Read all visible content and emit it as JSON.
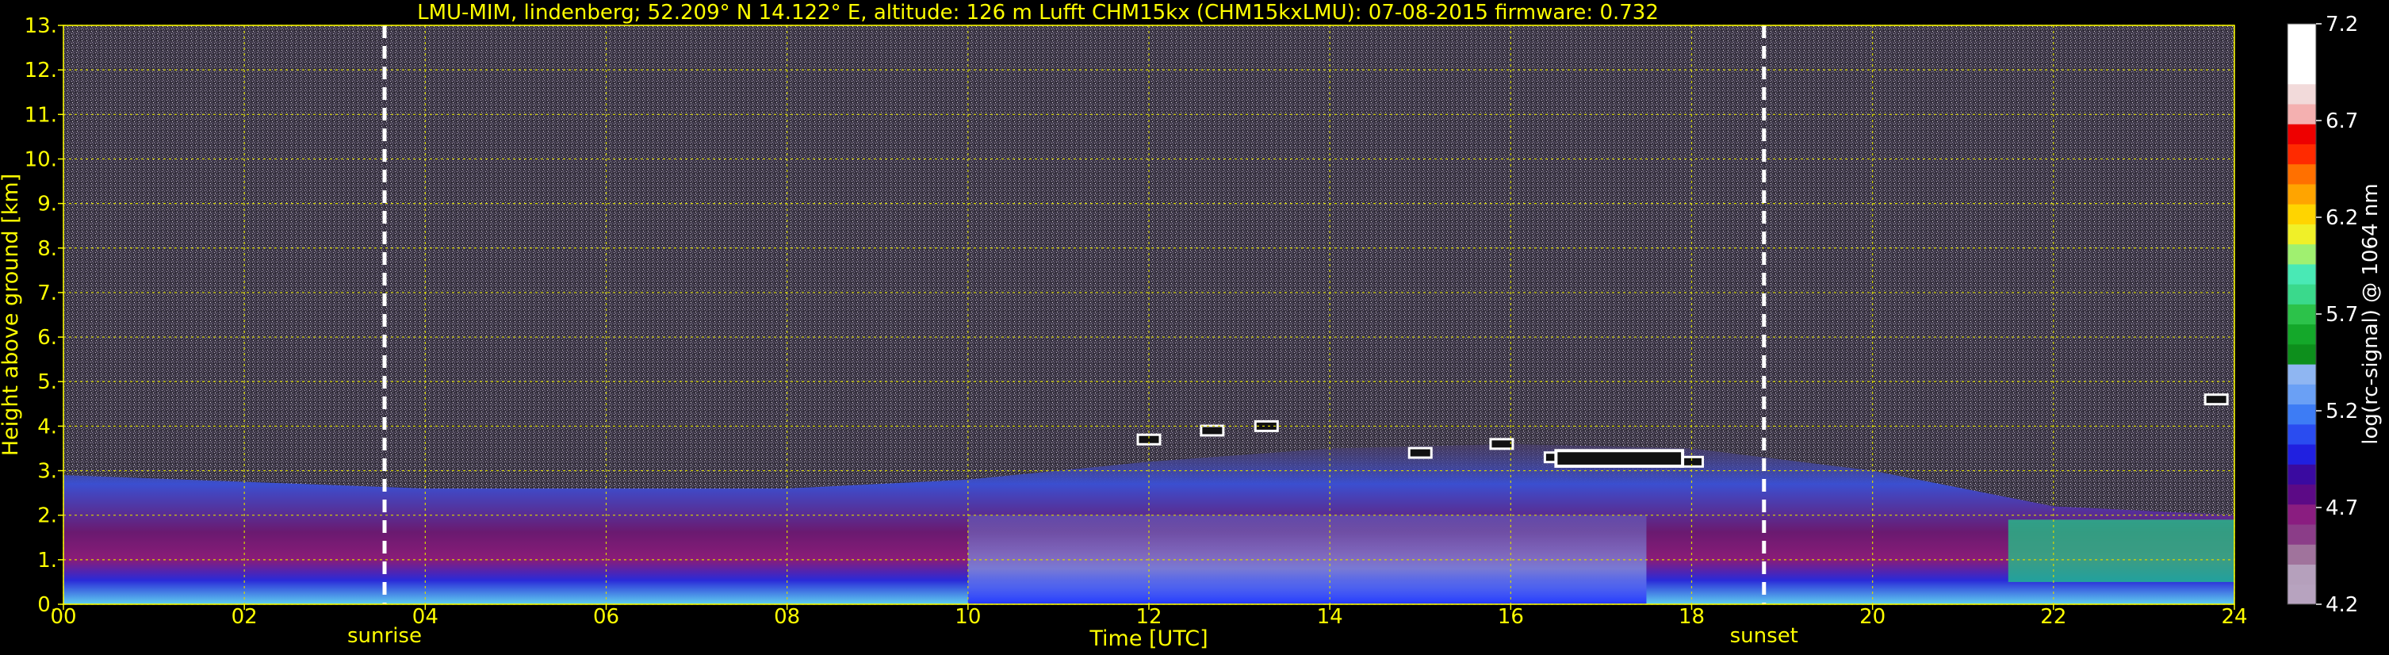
{
  "chart_data": {
    "type": "heatmap",
    "title": "LMU-MIM, lindenberg; 52.209° N 14.122° E, altitude: 126 m    Lufft CHM15kx (CHM15kxLMU): 07-08-2015    firmware: 0.732",
    "xlabel": "Time [UTC]",
    "ylabel": "Height above ground [km]",
    "xlim": [
      0,
      24
    ],
    "ylim": [
      0,
      13
    ],
    "x_ticks": [
      "00",
      "02",
      "04",
      "06",
      "08",
      "10",
      "12",
      "14",
      "16",
      "18",
      "20",
      "22",
      "24"
    ],
    "y_ticks": [
      "0.",
      "1.",
      "2.",
      "3.",
      "4.",
      "5.",
      "6.",
      "7.",
      "8.",
      "9.",
      "10.",
      "11.",
      "12.",
      "13."
    ],
    "grid": true,
    "markers": [
      {
        "label": "sunrise",
        "x": 3.55
      },
      {
        "label": "sunset",
        "x": 18.8
      }
    ],
    "colorbar": {
      "label": "log(rc-signal) @ 1064 nm",
      "range": [
        4.2,
        7.2
      ],
      "ticks": [
        "4.2",
        "4.7",
        "5.2",
        "5.7",
        "6.2",
        "6.7",
        "7.2"
      ]
    },
    "features": [
      {
        "name": "boundary layer top",
        "x": [
          0,
          4,
          8,
          10,
          12,
          14,
          16,
          18,
          20,
          22,
          24
        ],
        "y": [
          2.9,
          2.6,
          2.6,
          2.8,
          3.2,
          3.5,
          3.6,
          3.5,
          3.0,
          2.2,
          2.0
        ]
      },
      {
        "name": "cloud layer",
        "x": [
          12.0,
          12.7,
          13.3,
          15.0,
          15.9,
          16.5,
          17.5,
          18.0,
          23.8
        ],
        "y": [
          3.7,
          3.9,
          4.0,
          3.4,
          3.6,
          3.3,
          3.3,
          3.2,
          4.6
        ]
      }
    ]
  },
  "colors": {
    "background": "#000000",
    "axis_text": "#ffff00",
    "grid": "#d8d800",
    "marker_line": "#ffffff"
  }
}
